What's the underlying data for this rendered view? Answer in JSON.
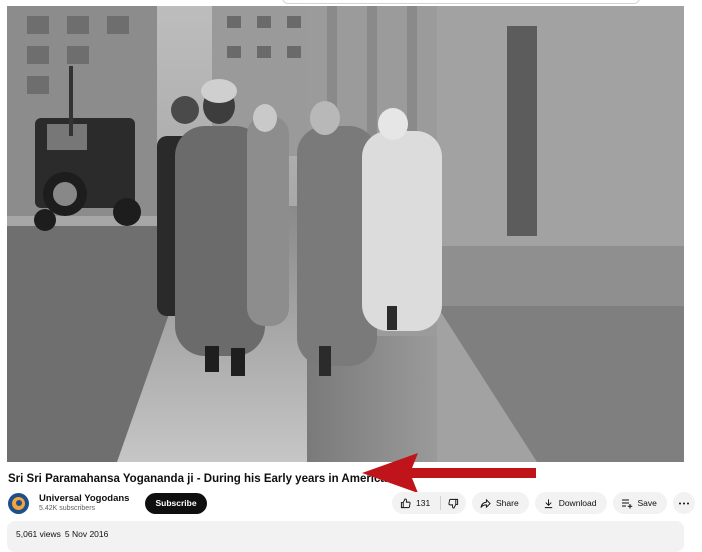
{
  "video": {
    "title": "Sri Sri Paramahansa Yogananda ji - During his Early years in America"
  },
  "channel": {
    "name": "Universal Yogodans",
    "subscribers": "5.42K subscribers",
    "subscribe_label": "Subscribe"
  },
  "actions": {
    "like_count": "131",
    "share_label": "Share",
    "download_label": "Download",
    "save_label": "Save"
  },
  "description": {
    "views": "5,061 views",
    "date": "5 Nov 2016"
  },
  "colors": {
    "annotation_arrow": "#c0141b",
    "subscribe_bg": "#0f0f0f",
    "pill_bg": "#f2f2f2"
  },
  "icons": [
    "thumbs-up-icon",
    "thumbs-down-icon",
    "share-icon",
    "download-icon",
    "save-playlist-icon",
    "more-icon"
  ]
}
